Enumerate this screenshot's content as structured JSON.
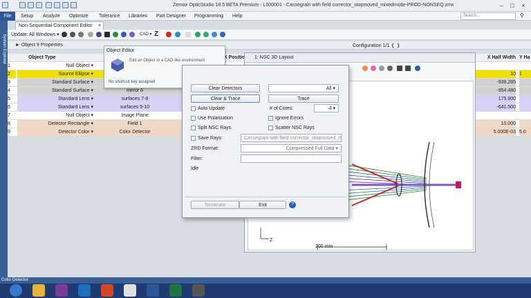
{
  "window": {
    "title": "Zemax OpticStudio 18.5  BETA  Premium - L000001 - Cassegrain with field corrector_stopmoved_mixedmode-PROD-NONSEQ.zmx"
  },
  "ribbon": {
    "file": "File",
    "tabs": [
      "Setup",
      "Analyze",
      "Optimize",
      "Tolerance",
      "Libraries",
      "Part Designer",
      "Programming",
      "Help"
    ],
    "search_placeholder": "Search..."
  },
  "sidebar": {
    "label": "System Explorer"
  },
  "editor": {
    "tab_label": "Non-Sequential Component Editor",
    "update_label": "Update: All Windows",
    "props_label": "Object 9 Properties",
    "configuration": "Configuration 1/1"
  },
  "grid": {
    "headers": {
      "num": "",
      "type": "Object Type",
      "seq": "",
      "x_pos": "X Positio",
      "x_half": "X Half Width",
      "y_half": "Y Ha"
    },
    "rows": [
      {
        "num": "1",
        "type": "Null Object",
        "comment": "Seque",
        "ref": "",
        "xhw": "",
        "yh": ""
      },
      {
        "num": "2",
        "type": "Source Ellipse",
        "comment": "",
        "ref": "",
        "xhw": "10",
        "yh": "1"
      },
      {
        "num": "3",
        "type": "Standard Surface",
        "comment": "",
        "ref": "",
        "xhw": "-939.285",
        "yh": ""
      },
      {
        "num": "4",
        "type": "Standard Surface",
        "comment": "mirror 6",
        "ref": "1",
        "xhw": "-954.480",
        "yh": ""
      },
      {
        "num": "5",
        "type": "Standard Lens",
        "comment": "surfaces 7-8",
        "ref": "1",
        "xhw": "175.900",
        "yh": ""
      },
      {
        "num": "6",
        "type": "Standard Lens",
        "comment": "surfaces 9-10",
        "ref": "1",
        "xhw": "-641.500",
        "yh": ""
      },
      {
        "num": "7",
        "type": "Null Object",
        "comment": "Image Plane",
        "ref": "1",
        "xhw": "",
        "yh": ""
      },
      {
        "num": "8",
        "type": "Detector Rectangle",
        "comment": "Field 1",
        "ref": "1",
        "xhw": "10.000",
        "yh": ""
      },
      {
        "num": "9",
        "type": "Detector Color",
        "comment": "Color Detector",
        "ref": "1",
        "xhw": "5.000E-03",
        "yh": "5.0"
      }
    ]
  },
  "tooltip": {
    "title": "Object Editor",
    "description": "Edit an Object in a CAD-like environment",
    "footer": "No shortcut key assigned"
  },
  "layout": {
    "title": "1: NSC 3D Layout",
    "scale_label": "200 mm",
    "axis_z": "Z"
  },
  "dialog": {
    "clear_detectors": "Clear Detectors",
    "all_option": "All",
    "clear_trace": "Clear & Trace",
    "trace": "Trace",
    "auto_update": "Auto Update",
    "cores_label": "# of Cores:",
    "cores_value": "4",
    "use_polarization": "Use Polarization",
    "ignore_errors": "Ignore Errors",
    "split_rays": "Split NSC Rays",
    "scatter_rays": "Scatter NSC Rays",
    "save_rays": "Save Rays:",
    "save_file": "Cassegrain with field corrector_stopmoved_mixe",
    "zrd_label": "ZRD Format:",
    "zrd_value": "Compressed Full Data",
    "filter_label": "Filter:",
    "status": "Idle",
    "terminate": "Terminate",
    "exit": "Exit"
  },
  "statusbar": {
    "text": "Color Detector"
  },
  "taskbar": {
    "apps": [
      "start-icon",
      "file-explorer-icon",
      "onenote-icon",
      "outlook-icon",
      "powerpoint-icon",
      "chrome-icon",
      "word-icon",
      "excel-icon",
      "zemax-icon"
    ]
  },
  "colors": {
    "accent": "#2b579a",
    "highlight_yellow": "#f0e000",
    "lens_purple": "#d9d0f5",
    "detector_tan": "#f0d8c4",
    "surface_gray": "#d2d2d2"
  }
}
